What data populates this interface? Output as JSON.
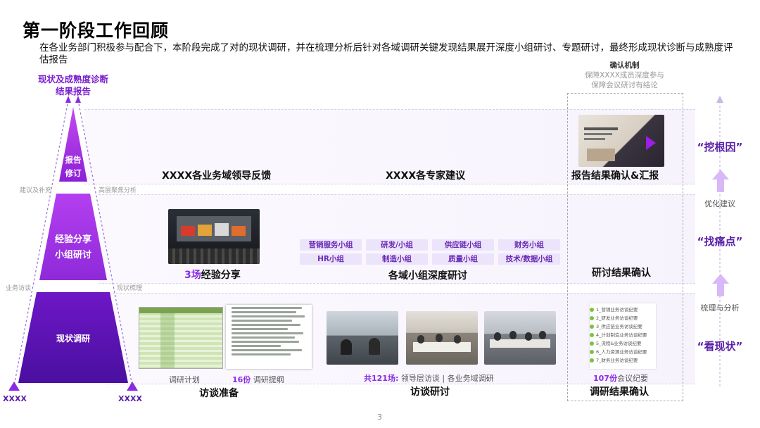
{
  "page": {
    "title": "第一阶段工作回顾",
    "subtitle": "在各业务部门积极参与配合下，本阶段完成了对的现状调研，并在梳理分析后针对各域调研关键发现结果展开深度小组研讨、专题研讨，最终形成现状诊断与成熟度评估报告",
    "page_number": "3"
  },
  "pyramid": {
    "top_caption_line1": "现状及成熟度诊断",
    "top_caption_line2": "结果报告",
    "level_top": "报告\n修订",
    "level_mid_line1": "经验分享",
    "level_mid_line2": "小组研讨",
    "level_bottom": "现状调研",
    "left_corner": "XXXX",
    "right_corner": "XXXX",
    "side_label_1_left": "建议及补充",
    "side_label_1_right": "高层聚焦分析",
    "side_label_2_left": "业务访谈",
    "side_label_2_right": "现状梳理"
  },
  "band_top": {
    "label_left": "XXXX各业务域领导反馈",
    "label_mid": "XXXX各专家建议",
    "label_right": "报告结果确认&汇报"
  },
  "band_mid": {
    "exp_count": "3场",
    "exp_label": "经验分享",
    "groups": [
      "营销服务小组",
      "研发/小组",
      "供应链小组",
      "财务小组",
      "HR小组",
      "制造小组",
      "质量小组",
      "技术/数据小组"
    ],
    "groups_label": "各域小组深度研讨",
    "confirm_label": "研讨结果确认"
  },
  "band_bottom": {
    "plan_caption": "调研计划",
    "outline_count": "16份",
    "outline_caption": "调研提纲",
    "prep_label": "访谈准备",
    "interview_count": "共121场:",
    "interview_caption": "领导层访谈 | 各业务域调研",
    "interview_label": "访谈研讨",
    "minutes_count": "107份",
    "minutes_caption": "会议纪要",
    "confirm_label": "调研结果确认",
    "minutes_items": [
      "1_营销业务访谈纪要",
      "2_研发业务访谈纪要",
      "3_供应链业务访谈纪要",
      "4_计划制造业务访谈纪要",
      "5_流程&业务访谈纪要",
      "6_人力资源业务访谈纪要",
      "7_财务业务访谈纪要"
    ]
  },
  "mechanism": {
    "title": "确认机制",
    "line1": "保障XXXX成员深度参与",
    "line2": "保障会议研讨有结论"
  },
  "right_side": {
    "tag_top": "“挖根因”",
    "note_top": "优化建议",
    "tag_mid": "“找痛点”",
    "note_mid": "梳理与分析",
    "tag_bottom": "“看现状”"
  }
}
